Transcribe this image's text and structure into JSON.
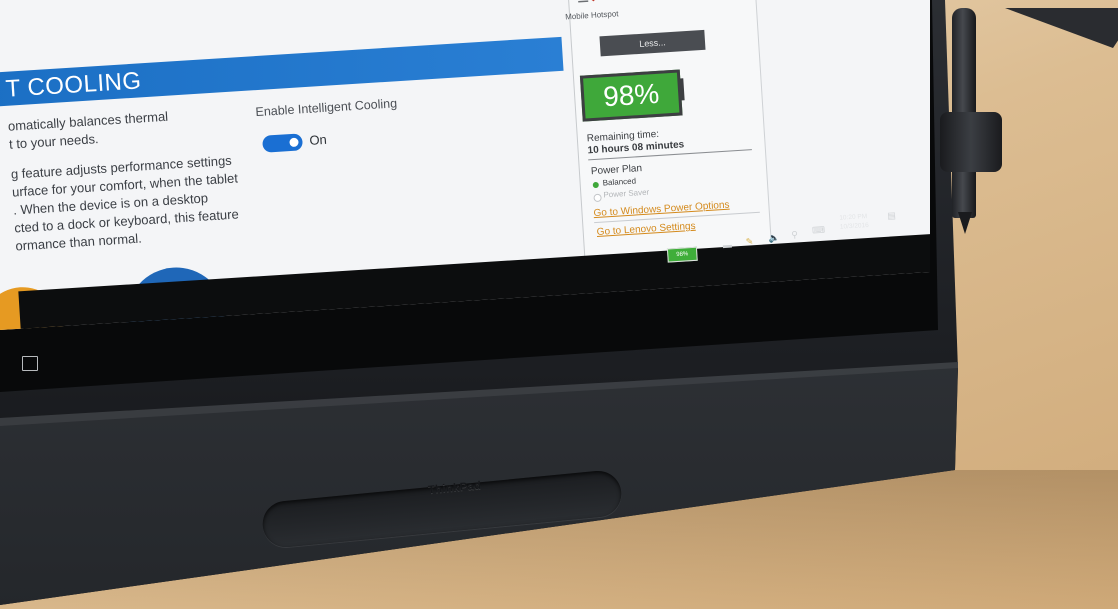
{
  "app": {
    "title": "T COOLING",
    "description_lines": [
      "omatically balances thermal",
      "t to your needs.",
      "g feature adjusts performance settings",
      "urface for your comfort, when the tablet",
      ". When the device is on a desktop",
      "cted to a dock or keyboard, this feature",
      "ormance than normal."
    ],
    "enable_label": "Enable Intelligent Cooling",
    "toggle_state": "On"
  },
  "flyout": {
    "hotspot_label": "Mobile Hotspot",
    "less_button": "Less...",
    "battery_percent": "98%",
    "remaining_label": "Remaining time:",
    "remaining_value": "10 hours 08 minutes",
    "power_plan_label": "Power Plan",
    "plans": [
      "Balanced",
      "Power Saver"
    ],
    "links": [
      "Go to Windows Power Options",
      "Go to Lenovo Settings"
    ]
  },
  "taskbar": {
    "battery_percent": "98%",
    "time": "10:20 PM",
    "date": "10/3/2016"
  },
  "device": {
    "brand": "ThinkPad"
  },
  "colors": {
    "header_blue": "#1b6fc4",
    "battery_green": "#3fa83a",
    "link_orange": "#d48a1c",
    "toggle_blue": "#1a6fd3"
  }
}
